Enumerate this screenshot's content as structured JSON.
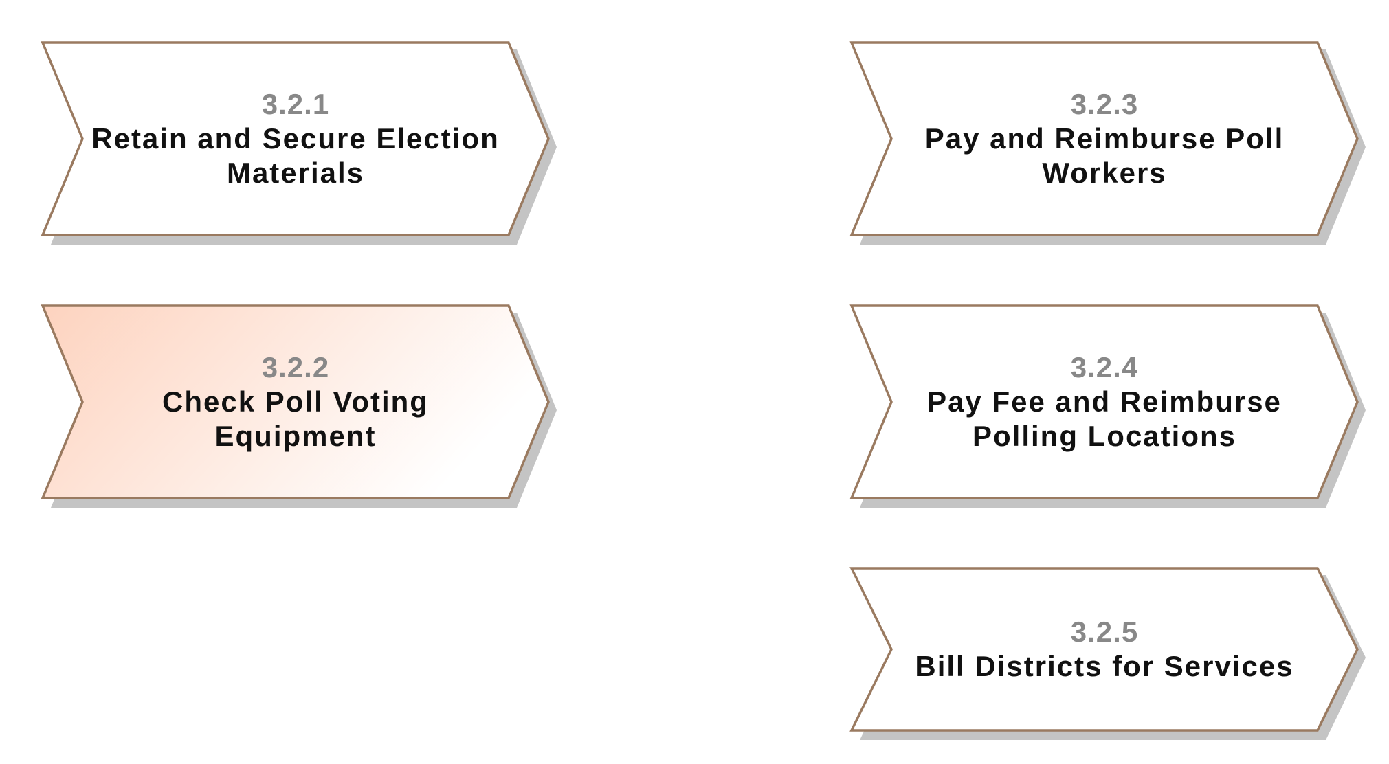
{
  "colors": {
    "border": "#9a7a60",
    "shadow": "#c4c4c4",
    "fill": "#ffffff",
    "highlight_start": "#fdd3bf",
    "highlight_end": "#ffffff",
    "number": "#888888",
    "title": "#111111"
  },
  "shapes": [
    {
      "number": "3.2.1",
      "title_line1": "Retain and Secure Election",
      "title_line2": "Materials",
      "highlighted": false
    },
    {
      "number": "3.2.2",
      "title_line1": "Check Poll Voting",
      "title_line2": "Equipment",
      "highlighted": true
    },
    {
      "number": "3.2.3",
      "title_line1": "Pay and Reimburse Poll",
      "title_line2": "Workers",
      "highlighted": false
    },
    {
      "number": "3.2.4",
      "title_line1": "Pay Fee and Reimburse",
      "title_line2": "Polling Locations",
      "highlighted": false
    },
    {
      "number": "3.2.5",
      "title_line1": "Bill Districts for Services",
      "title_line2": "",
      "highlighted": false
    }
  ]
}
